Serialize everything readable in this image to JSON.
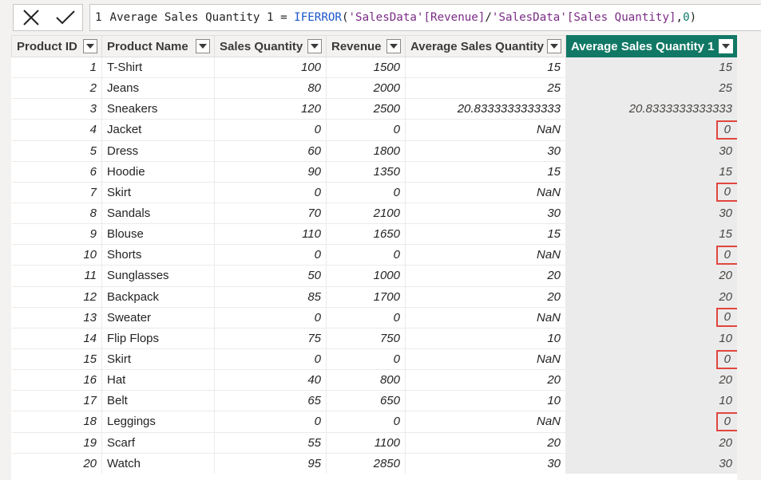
{
  "formula_bar": {
    "cancel_icon": "close-icon",
    "commit_icon": "check-icon",
    "line_number": "1",
    "tokens": [
      {
        "t": "Average Sales Quantity 1 = ",
        "k": "txt"
      },
      {
        "t": "IFERROR",
        "k": "fn"
      },
      {
        "t": "(",
        "k": "txt"
      },
      {
        "t": "'SalesData'",
        "k": "str"
      },
      {
        "t": "[Revenue]",
        "k": "str"
      },
      {
        "t": "/",
        "k": "txt"
      },
      {
        "t": "'SalesData'",
        "k": "str"
      },
      {
        "t": "[Sales Quantity]",
        "k": "str"
      },
      {
        "t": ",",
        "k": "txt"
      },
      {
        "t": "0",
        "k": "num"
      },
      {
        "t": ")",
        "k": "txt"
      }
    ]
  },
  "table": {
    "columns": [
      {
        "label": "Product ID",
        "align": "num"
      },
      {
        "label": "Product Name",
        "align": "txt"
      },
      {
        "label": "Sales Quantity",
        "align": "num"
      },
      {
        "label": "Revenue",
        "align": "num"
      },
      {
        "label": "Average Sales Quantity",
        "align": "num"
      },
      {
        "label": "Average Sales Quantity 1",
        "align": "num",
        "selected": true
      }
    ],
    "rows": [
      [
        "1",
        "T-Shirt",
        "100",
        "1500",
        "15",
        "15"
      ],
      [
        "2",
        "Jeans",
        "80",
        "2000",
        "25",
        "25"
      ],
      [
        "3",
        "Sneakers",
        "120",
        "2500",
        "20.8333333333333",
        "20.8333333333333"
      ],
      [
        "4",
        "Jacket",
        "0",
        "0",
        "NaN",
        "0"
      ],
      [
        "5",
        "Dress",
        "60",
        "1800",
        "30",
        "30"
      ],
      [
        "6",
        "Hoodie",
        "90",
        "1350",
        "15",
        "15"
      ],
      [
        "7",
        "Skirt",
        "0",
        "0",
        "NaN",
        "0"
      ],
      [
        "8",
        "Sandals",
        "70",
        "2100",
        "30",
        "30"
      ],
      [
        "9",
        "Blouse",
        "110",
        "1650",
        "15",
        "15"
      ],
      [
        "10",
        "Shorts",
        "0",
        "0",
        "NaN",
        "0"
      ],
      [
        "11",
        "Sunglasses",
        "50",
        "1000",
        "20",
        "20"
      ],
      [
        "12",
        "Backpack",
        "85",
        "1700",
        "20",
        "20"
      ],
      [
        "13",
        "Sweater",
        "0",
        "0",
        "NaN",
        "0"
      ],
      [
        "14",
        "Flip Flops",
        "75",
        "750",
        "10",
        "10"
      ],
      [
        "15",
        "Skirt",
        "0",
        "0",
        "NaN",
        "0"
      ],
      [
        "16",
        "Hat",
        "40",
        "800",
        "20",
        "20"
      ],
      [
        "17",
        "Belt",
        "65",
        "650",
        "10",
        "10"
      ],
      [
        "18",
        "Leggings",
        "0",
        "0",
        "NaN",
        "0"
      ],
      [
        "19",
        "Scarf",
        "55",
        "1100",
        "20",
        "20"
      ],
      [
        "20",
        "Watch",
        "95",
        "2850",
        "30",
        "30"
      ]
    ],
    "highlighted_rows": [
      3,
      6,
      9,
      12,
      14,
      17
    ],
    "colors": {
      "selected_header": "#117865",
      "highlight_box": "#e0463f",
      "selected_column_bg": "#ebebeb"
    }
  }
}
